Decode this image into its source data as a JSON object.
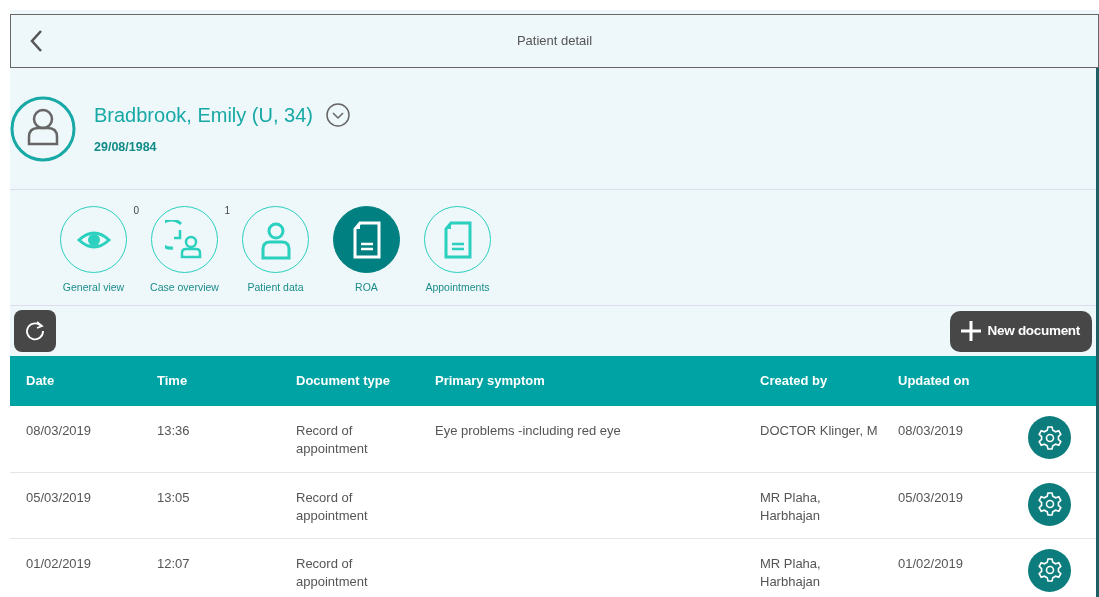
{
  "header": {
    "title": "Patient detail"
  },
  "patient": {
    "name": "Bradbrook, Emily (U, 34)",
    "dob": "29/08/1984"
  },
  "nav_items": [
    {
      "label": "General view",
      "count": "0",
      "selected": false
    },
    {
      "label": "Case overview",
      "count": "1",
      "selected": false
    },
    {
      "label": "Patient data",
      "selected": false
    },
    {
      "label": "ROA",
      "selected": true
    },
    {
      "label": "Appointments",
      "selected": false
    }
  ],
  "toolbar": {
    "new_button": "New document"
  },
  "table": {
    "columns": [
      "Date",
      "Time",
      "Document type",
      "Primary symptom",
      "Created by",
      "Updated on"
    ],
    "rows": [
      {
        "cells": [
          "08/03/2019",
          "13:36",
          "Record of appointment",
          "Eye problems -including red eye",
          "DOCTOR Klinger, M",
          "08/03/2019"
        ]
      },
      {
        "cells": [
          "05/03/2019",
          "13:05",
          "Record of appointment",
          "",
          "MR Plaha, Harbhajan",
          "05/03/2019"
        ]
      },
      {
        "cells": [
          "01/02/2019",
          "12:07",
          "Record of appointment",
          "",
          "MR Plaha, Harbhajan",
          "01/02/2019"
        ]
      }
    ]
  }
}
